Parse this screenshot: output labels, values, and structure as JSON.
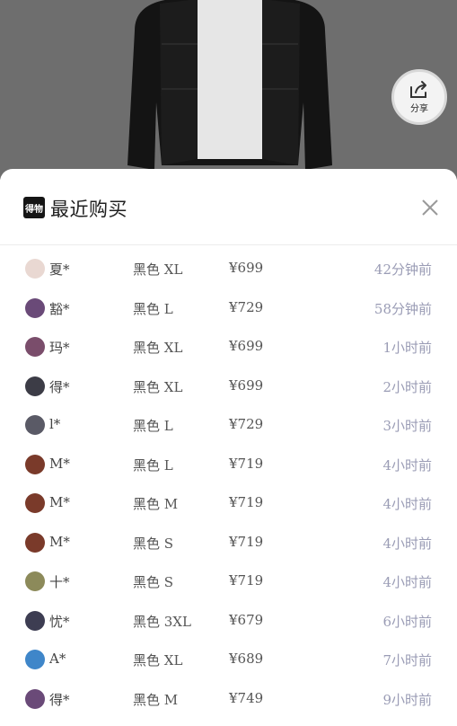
{
  "share": {
    "label": "分享",
    "icon": "share-icon"
  },
  "panel": {
    "logo_text": "得物",
    "title": "最近购买",
    "close_icon": "close-icon"
  },
  "purchases": [
    {
      "name": "夏*",
      "spec": "黑色 XL",
      "price": "¥699",
      "time": "42分钟前",
      "avatar_color": "#e9d8d2"
    },
    {
      "name": "豁*",
      "spec": "黑色 L",
      "price": "¥729",
      "time": "58分钟前",
      "avatar_color": "#6a4a78"
    },
    {
      "name": "玛*",
      "spec": "黑色 XL",
      "price": "¥699",
      "time": "1小时前",
      "avatar_color": "#7a4d6b"
    },
    {
      "name": "得*",
      "spec": "黑色 XL",
      "price": "¥699",
      "time": "2小时前",
      "avatar_color": "#3c3c46"
    },
    {
      "name": "l*",
      "spec": "黑色 L",
      "price": "¥729",
      "time": "3小时前",
      "avatar_color": "#5a5a66"
    },
    {
      "name": "M*",
      "spec": "黑色 L",
      "price": "¥719",
      "time": "4小时前",
      "avatar_color": "#7a3a2a"
    },
    {
      "name": "M*",
      "spec": "黑色 M",
      "price": "¥719",
      "time": "4小时前",
      "avatar_color": "#7a3a2a"
    },
    {
      "name": "M*",
      "spec": "黑色 S",
      "price": "¥719",
      "time": "4小时前",
      "avatar_color": "#7a3a2a"
    },
    {
      "name": "十*",
      "spec": "黑色 S",
      "price": "¥719",
      "time": "4小时前",
      "avatar_color": "#8c8a5a"
    },
    {
      "name": "忧*",
      "spec": "黑色 3XL",
      "price": "¥679",
      "time": "6小时前",
      "avatar_color": "#3d3d52"
    },
    {
      "name": "A*",
      "spec": "黑色 XL",
      "price": "¥689",
      "time": "7小时前",
      "avatar_color": "#3f86c9"
    },
    {
      "name": "得*",
      "spec": "黑色 M",
      "price": "¥749",
      "time": "9小时前",
      "avatar_color": "#6a4a78"
    }
  ]
}
